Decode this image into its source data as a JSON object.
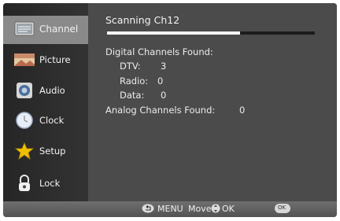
{
  "sidebar": {
    "items": [
      {
        "label": "Channel",
        "icon": "channel-icon",
        "active": true
      },
      {
        "label": "Picture",
        "icon": "picture-icon",
        "active": false
      },
      {
        "label": "Audio",
        "icon": "audio-icon",
        "active": false
      },
      {
        "label": "Clock",
        "icon": "clock-icon",
        "active": false
      },
      {
        "label": "Setup",
        "icon": "setup-star-icon",
        "active": false
      },
      {
        "label": "Lock",
        "icon": "lock-icon",
        "active": false
      }
    ]
  },
  "scan": {
    "title": "Scanning Ch12",
    "progress_fraction": 0.64,
    "digital_heading": "Digital Channels Found:",
    "dtv_label": "DTV:",
    "dtv_value": "3",
    "radio_label": "Radio:",
    "radio_value": "0",
    "data_label": "Data:",
    "data_value": "0",
    "analog_label": "Analog Channels Found:",
    "analog_value": "0"
  },
  "footer": {
    "menu_label": "MENU",
    "move_label": "Move",
    "ok_label": "OK",
    "ok_button_text": "OK"
  },
  "colors": {
    "active_item": "#8a8a8a",
    "panel": "#4b4b4b",
    "sidebar": "#2e2e2e",
    "progress_fill": "#f4f4f4"
  }
}
